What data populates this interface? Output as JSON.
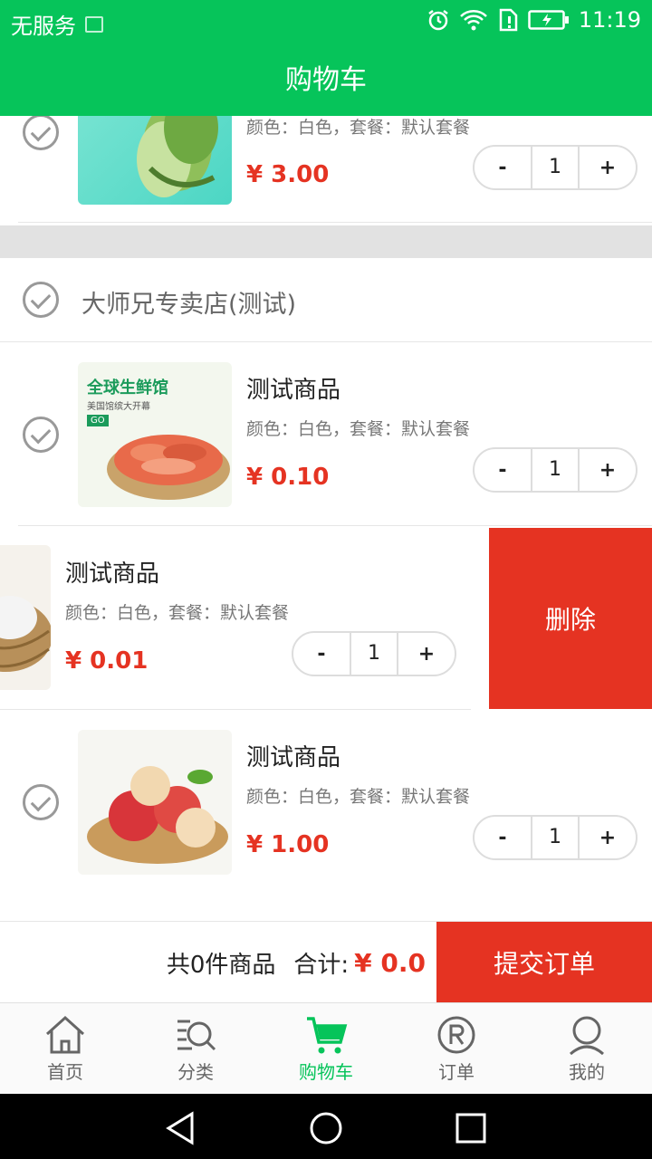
{
  "status_bar": {
    "carrier": "无服务",
    "time": "11:19"
  },
  "header": {
    "title": "购物车"
  },
  "currency": "¥",
  "top_item": {
    "spec": "颜色：白色，套餐：默认套餐",
    "price": "¥ 3.00",
    "qty": "1"
  },
  "store": {
    "name": "大师兄专卖店(测试)"
  },
  "items": [
    {
      "title": "测试商品",
      "spec": "颜色：白色，套餐：默认套餐",
      "price": "¥ 0.10",
      "qty": "1",
      "thumb_text": "全球生鲜馆",
      "thumb_sub": "美国馆缤大开幕",
      "thumb_go": "GO"
    },
    {
      "title": "测试商品",
      "spec": "颜色：白色，套餐：默认套餐",
      "price": "¥ 0.01",
      "qty": "1"
    },
    {
      "title": "测试商品",
      "spec": "颜色：白色，套餐：默认套餐",
      "price": "¥ 1.00",
      "qty": "1"
    }
  ],
  "stepper": {
    "minus": "-",
    "plus": "+"
  },
  "swipe_action": {
    "delete_label": "删除"
  },
  "footer": {
    "count_text": "共0件商品",
    "total_label": "合计:",
    "total_value": "¥ 0.0",
    "submit_label": "提交订单"
  },
  "tabs": [
    {
      "label": "首页",
      "icon": "home-icon",
      "active": false
    },
    {
      "label": "分类",
      "icon": "category-search-icon",
      "active": false
    },
    {
      "label": "购物车",
      "icon": "cart-icon",
      "active": true
    },
    {
      "label": "订单",
      "icon": "order-icon",
      "active": false
    },
    {
      "label": "我的",
      "icon": "profile-icon",
      "active": false
    }
  ],
  "colors": {
    "brand_green": "#06c45a",
    "accent_red": "#e53322",
    "text_gray": "#777777"
  }
}
